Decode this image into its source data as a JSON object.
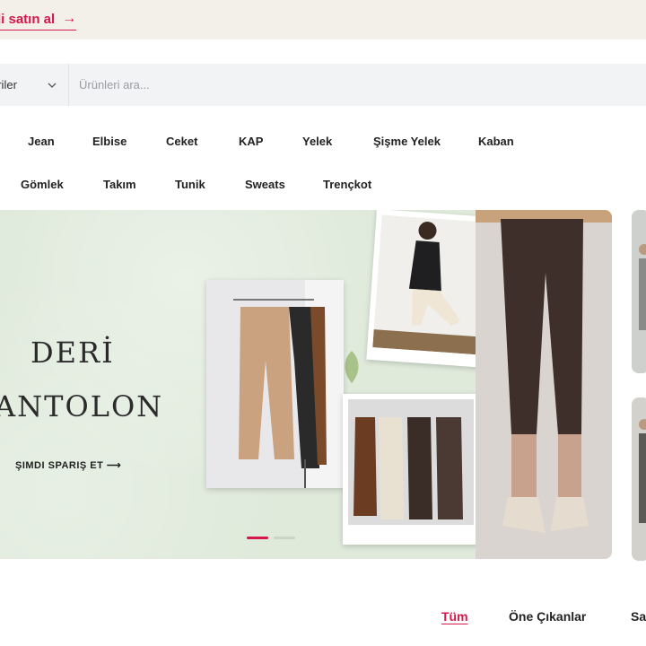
{
  "announcement": {
    "link_label": "di satın al",
    "arrow": "→"
  },
  "search": {
    "category_label": "priler",
    "placeholder": "Ürünleri ara..."
  },
  "nav": {
    "row1": [
      "Jean",
      "Elbise",
      "Ceket",
      "KAP",
      "Yelek",
      "Şişme Yelek",
      "Kaban"
    ],
    "row2": [
      "Gömlek",
      "Takım",
      "Tunik",
      "Sweats",
      "Trençkot"
    ]
  },
  "hero": {
    "title_line1": "DERİ",
    "title_line2": "ANTOLON",
    "cta": "ŞIMDI SPARIŞ ET ⟶",
    "slides_total": 2,
    "active_slide": 1
  },
  "tabs": [
    {
      "label": "Tüm",
      "active": true
    },
    {
      "label": "Öne Çıkanlar",
      "active": false
    },
    {
      "label": "Sa",
      "active": false
    }
  ],
  "colors": {
    "accent": "#d4184a",
    "announce_bg": "#f3efe9",
    "hero_bg": "#dfeadb",
    "search_bg": "#f2f3f5"
  }
}
